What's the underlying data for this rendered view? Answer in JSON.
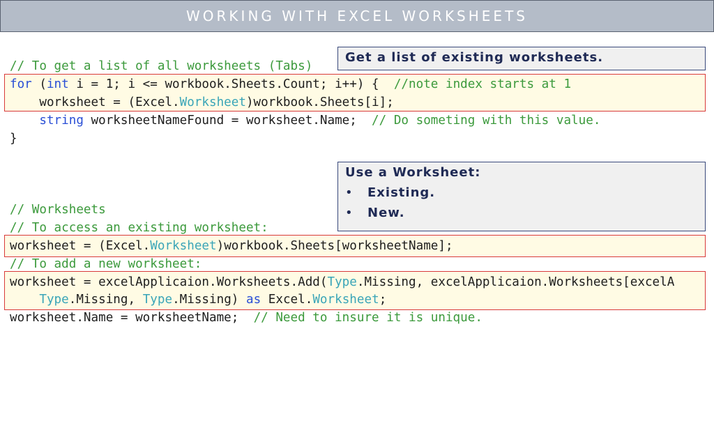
{
  "slide": {
    "title": "WORKING WITH EXCEL WORKSHEETS"
  },
  "callouts": {
    "list_existing": "Get a list of existing worksheets.",
    "use_worksheet": {
      "heading": "Use a Worksheet:",
      "bullets": [
        "Existing.",
        "New."
      ]
    }
  },
  "code_block_1": {
    "line1": "// To get a list of all worksheets (Tabs)",
    "line2_kw1": "for",
    "line2_a": " (",
    "line2_kw2": "int",
    "line2_b": " i = 1; i <= workbook.Sheets.Count; i++) {  ",
    "line2_cmt": "//note index starts at 1",
    "line3_a": "    worksheet = (Excel.",
    "line3_ty": "Worksheet",
    "line3_b": ")workbook.Sheets[i];",
    "line4_a": "    ",
    "line4_kw": "string",
    "line4_b": " worksheetNameFound = worksheet.Name;  ",
    "line4_cmt": "// Do someting with this value.",
    "line5": "}"
  },
  "code_block_2": {
    "line1": "// Worksheets",
    "line2": "// To access an existing worksheet:",
    "line3_a": "worksheet = (Excel.",
    "line3_ty": "Worksheet",
    "line3_b": ")workbook.Sheets[worksheetName];",
    "line4": "// To add a new worksheet:",
    "line5_a": "worksheet = excelApplicaion.Worksheets.Add(",
    "line5_ty": "Type",
    "line5_b": ".Missing, excelApplicaion.Worksheets[excelA",
    "line6_a": "    ",
    "line6_ty1": "Type",
    "line6_b": ".Missing, ",
    "line6_ty2": "Type",
    "line6_c": ".Missing) ",
    "line6_kw": "as",
    "line6_d": " Excel.",
    "line6_ty3": "Worksheet",
    "line6_e": ";",
    "line7_a": "worksheet.Name = worksheetName;  ",
    "line7_cmt": "// Need to insure it is unique."
  }
}
